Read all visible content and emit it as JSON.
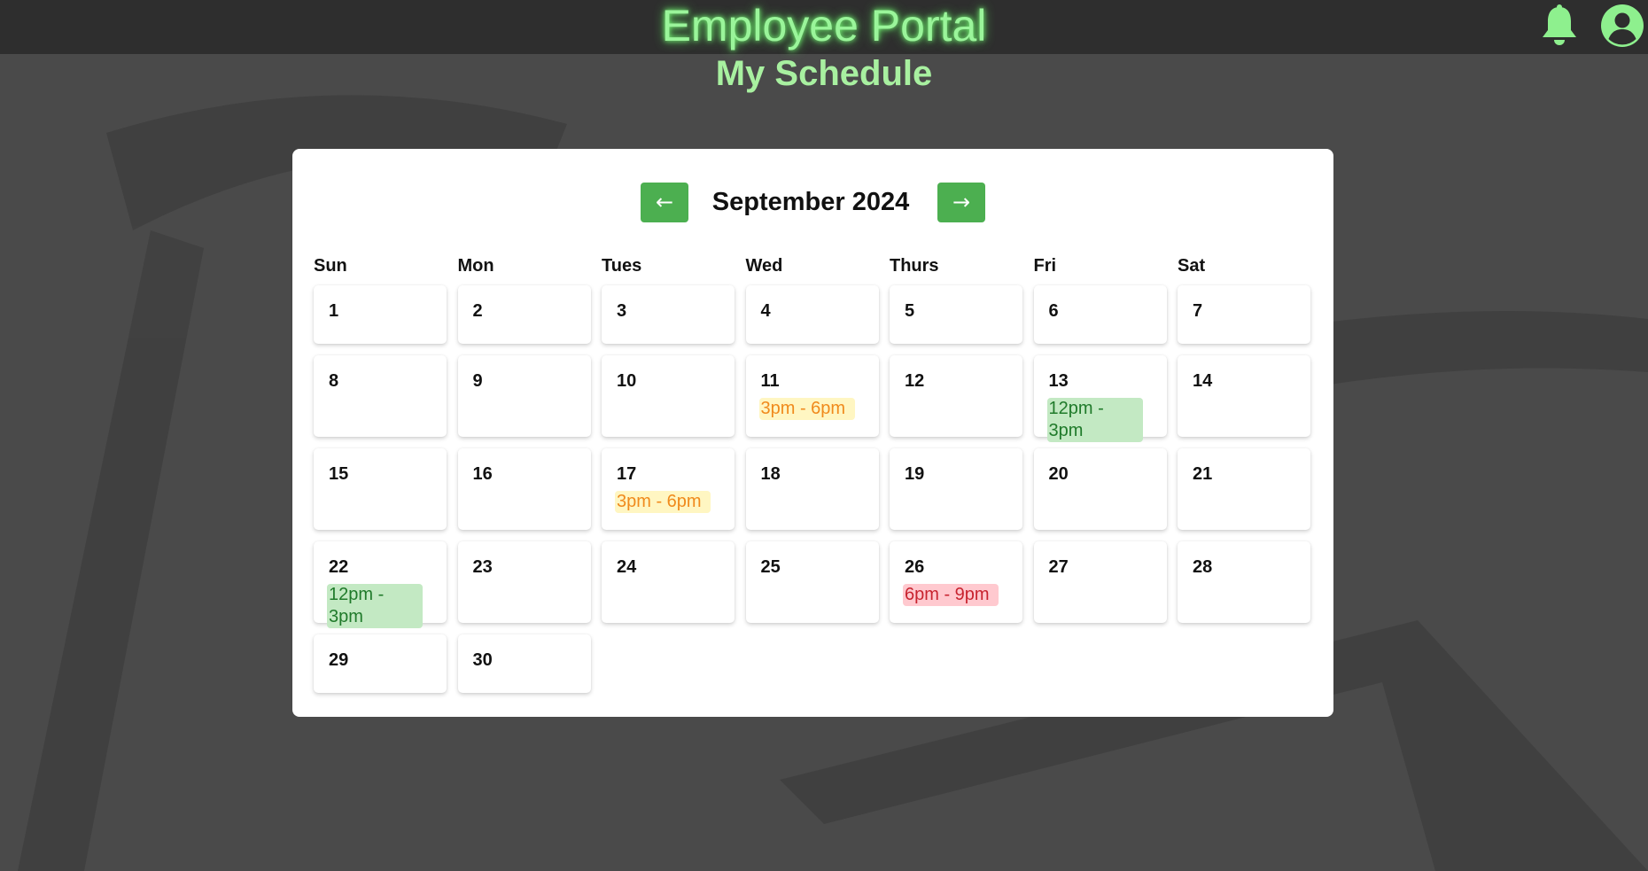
{
  "header": {
    "app_title": "Employee Portal",
    "notifications_icon": "bell-icon",
    "profile_icon": "user-circle-icon",
    "accent_color": "#9af59a"
  },
  "page": {
    "title": "My Schedule"
  },
  "calendar": {
    "prev_label": "←",
    "next_label": "→",
    "month_label": "September 2024",
    "weekdays": [
      "Sun",
      "Mon",
      "Tues",
      "Wed",
      "Thurs",
      "Fri",
      "Sat"
    ],
    "weeks": [
      [
        {
          "day": "1"
        },
        {
          "day": "2"
        },
        {
          "day": "3"
        },
        {
          "day": "4"
        },
        {
          "day": "5"
        },
        {
          "day": "6"
        },
        {
          "day": "7"
        }
      ],
      [
        {
          "day": "8"
        },
        {
          "day": "9"
        },
        {
          "day": "10"
        },
        {
          "day": "11",
          "shift": "3pm - 6pm",
          "color": "yellow"
        },
        {
          "day": "12"
        },
        {
          "day": "13",
          "shift": "12pm - 3pm",
          "color": "green"
        },
        {
          "day": "14"
        }
      ],
      [
        {
          "day": "15"
        },
        {
          "day": "16"
        },
        {
          "day": "17",
          "shift": "3pm - 6pm",
          "color": "yellow"
        },
        {
          "day": "18"
        },
        {
          "day": "19"
        },
        {
          "day": "20"
        },
        {
          "day": "21"
        }
      ],
      [
        {
          "day": "22",
          "shift": "12pm - 3pm",
          "color": "green"
        },
        {
          "day": "23"
        },
        {
          "day": "24"
        },
        {
          "day": "25"
        },
        {
          "day": "26",
          "shift": "6pm - 9pm",
          "color": "red"
        },
        {
          "day": "27"
        },
        {
          "day": "28"
        }
      ],
      [
        {
          "day": "29"
        },
        {
          "day": "30"
        }
      ]
    ],
    "shift_colors": {
      "yellow": "#fff6c2",
      "green": "#c3e9c3",
      "red": "#ffc9cf"
    },
    "button_color": "#4caf50"
  }
}
